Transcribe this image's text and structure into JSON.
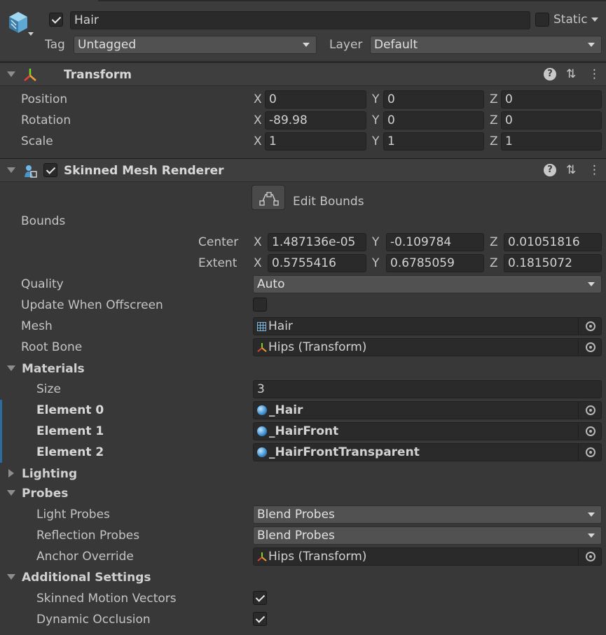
{
  "object": {
    "name": "Hair",
    "active": true,
    "static_label": "Static",
    "static_checked": false,
    "tag_label": "Tag",
    "tag_value": "Untagged",
    "layer_label": "Layer",
    "layer_value": "Default"
  },
  "transform": {
    "title": "Transform",
    "rows": [
      {
        "label": "Position",
        "x": "0",
        "y": "0",
        "z": "0"
      },
      {
        "label": "Rotation",
        "x": "-89.98",
        "y": "0",
        "z": "0"
      },
      {
        "label": "Scale",
        "x": "1",
        "y": "1",
        "z": "1"
      }
    ]
  },
  "axes": {
    "x": "X",
    "y": "Y",
    "z": "Z"
  },
  "smr": {
    "title": "Skinned Mesh Renderer",
    "enabled": true,
    "edit_bounds_label": "Edit Bounds",
    "bounds_label": "Bounds",
    "center_label": "Center",
    "center": {
      "x": "1.487136e-05",
      "y": "-0.109784",
      "z": "0.01051816"
    },
    "extent_label": "Extent",
    "extent": {
      "x": "0.5755416",
      "y": "0.6785059",
      "z": "0.1815072"
    },
    "quality_label": "Quality",
    "quality_value": "Auto",
    "update_offscreen_label": "Update When Offscreen",
    "update_offscreen": false,
    "mesh_label": "Mesh",
    "mesh_value": "Hair",
    "root_bone_label": "Root Bone",
    "root_bone_value": "Hips (Transform)",
    "materials": {
      "title": "Materials",
      "size_label": "Size",
      "size_value": "3",
      "elements": [
        {
          "label": "Element 0",
          "value": "_Hair"
        },
        {
          "label": "Element 1",
          "value": "_HairFront"
        },
        {
          "label": "Element 2",
          "value": "_HairFrontTransparent"
        }
      ]
    },
    "lighting_title": "Lighting",
    "probes": {
      "title": "Probes",
      "light_probes_label": "Light Probes",
      "light_probes_value": "Blend Probes",
      "reflection_probes_label": "Reflection Probes",
      "reflection_probes_value": "Blend Probes",
      "anchor_override_label": "Anchor Override",
      "anchor_override_value": "Hips (Transform)"
    },
    "additional": {
      "title": "Additional Settings",
      "skinned_motion_vectors_label": "Skinned Motion Vectors",
      "skinned_motion_vectors": true,
      "dynamic_occlusion_label": "Dynamic Occlusion",
      "dynamic_occlusion": true
    }
  },
  "colors": {
    "accent": "#2c6ca3",
    "background": "#383838",
    "field": "#2a2a2a"
  }
}
